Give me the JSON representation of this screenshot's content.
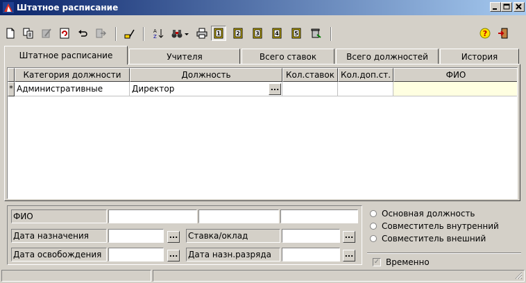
{
  "window": {
    "title": "Штатное расписание",
    "minimize_label": "_",
    "maximize_label": "□",
    "close_label": "×"
  },
  "toolbar": {
    "icons": [
      "new-document-icon",
      "copy-icon",
      "edit-icon",
      "refresh-icon",
      "undo-icon",
      "export-icon",
      "check-icon",
      "sort-icon",
      "binoculars-icon",
      "dropdown-icon",
      "print-icon",
      "page-1-icon",
      "page-2-icon",
      "page-3-icon",
      "page-4-icon",
      "page-5-icon",
      "trash-icon",
      "help-icon",
      "exit-icon"
    ],
    "page_labels": [
      "1",
      "2",
      "3",
      "4",
      "5"
    ],
    "help_label": "?",
    "sort_label": "A↓"
  },
  "tabs": [
    {
      "label": "Штатное расписание",
      "active": true
    },
    {
      "label": "Учителя",
      "active": false
    },
    {
      "label": "Всего ставок",
      "active": false
    },
    {
      "label": "Всего должностей",
      "active": false
    },
    {
      "label": "История",
      "active": false
    }
  ],
  "grid": {
    "columns": [
      "Категория должности",
      "Должность",
      "Кол.ставок",
      "Кол.доп.ст.",
      "ФИО"
    ],
    "rows": [
      {
        "indicator": "*",
        "category": "Административные",
        "position": "Директор",
        "rates": "",
        "extra_rates": "",
        "fio": ""
      }
    ],
    "ellipsis_label": "..."
  },
  "form": {
    "fio_label": "ФИО",
    "appointment_date_label": "Дата назначения",
    "rate_label": "Ставка/оклад",
    "release_date_label": "Дата освобождения",
    "grade_date_label": "Дата назн.разряда",
    "ellipsis_label": "..."
  },
  "employment": {
    "options": [
      "Основная должность",
      "Совместитель внутренний",
      "Совместитель внешний"
    ],
    "temporary_label": "Временно",
    "temporary_checked": true,
    "temporary_mark": "✓"
  },
  "colors": {
    "title_start": "#0a246a",
    "title_end": "#a6caf0",
    "face": "#d4d0c8",
    "highlight_cell": "#ffffe1"
  }
}
